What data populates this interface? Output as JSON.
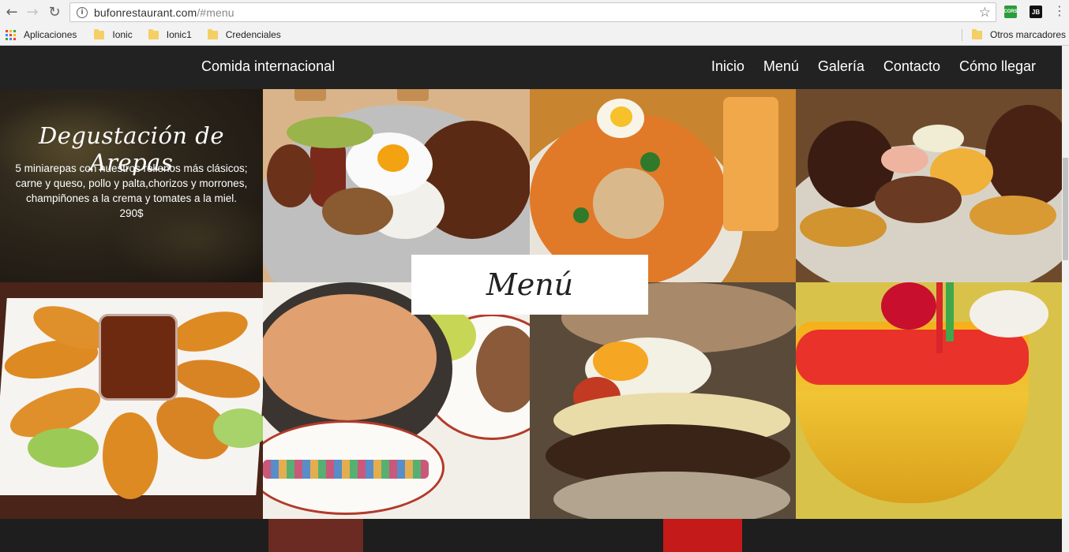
{
  "browser": {
    "url_host": "bufonrestaurant.com",
    "url_path": "/#menu",
    "extensions": [
      "CORS",
      "JB"
    ],
    "bookmarks": [
      "Aplicaciones",
      "Ionic",
      "Ionic1",
      "Credenciales"
    ],
    "other_bookmarks": "Otros marcadores"
  },
  "nav": {
    "brand": "Comida internacional",
    "links": [
      "Inicio",
      "Menú",
      "Galería",
      "Contacto",
      "Cómo llegar"
    ]
  },
  "promo": {
    "title": "Degustación de Arepas",
    "line1": "5 miniarepas con nuestros rellenos más clásicos;",
    "line2": "carne y queso, pollo y palta,chorizos y morrones,",
    "line3": "champiñones a la crema y tomates a la miel.",
    "price": "290$"
  },
  "section": {
    "title": "Menú"
  }
}
